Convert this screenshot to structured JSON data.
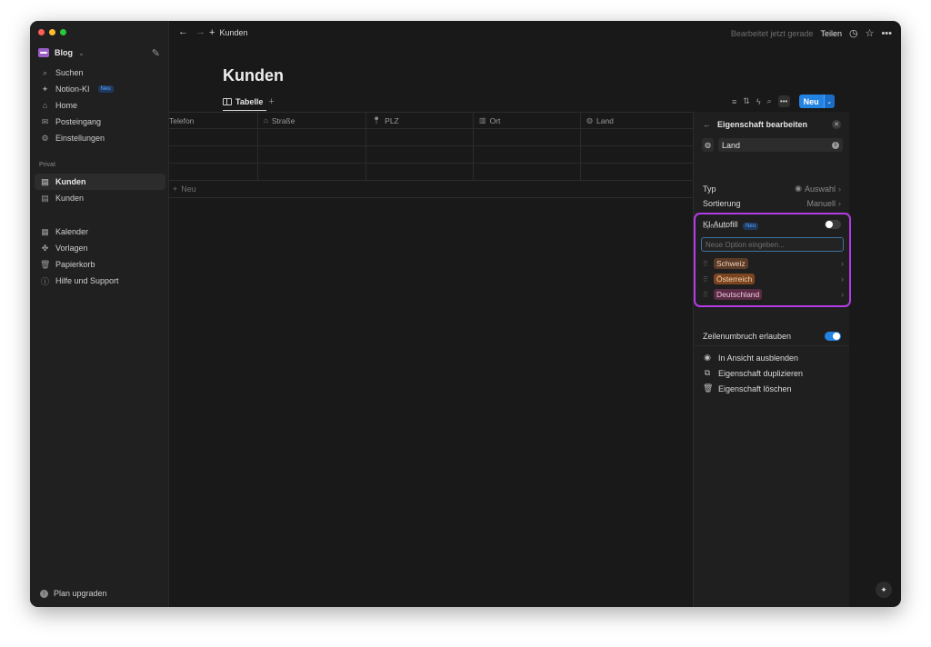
{
  "workspace": {
    "name": "Blog"
  },
  "sidebar": {
    "items": [
      {
        "label": "Suchen",
        "icon": "search-icon"
      },
      {
        "label": "Notion-KI",
        "icon": "sparkle-icon",
        "badge": "Neu"
      },
      {
        "label": "Home",
        "icon": "home-icon"
      },
      {
        "label": "Posteingang",
        "icon": "inbox-icon"
      },
      {
        "label": "Einstellungen",
        "icon": "gear-icon"
      }
    ],
    "private_label": "Privat",
    "pages": [
      {
        "label": "Kunden",
        "active": true
      },
      {
        "label": "Kunden",
        "active": false
      }
    ],
    "bottom_items": [
      {
        "label": "Kalender",
        "icon": "calendar-icon"
      },
      {
        "label": "Vorlagen",
        "icon": "templates-icon"
      },
      {
        "label": "Papierkorb",
        "icon": "trash-icon"
      },
      {
        "label": "Hilfe und Support",
        "icon": "help-icon"
      }
    ],
    "upgrade": "Plan upgraden"
  },
  "topbar": {
    "breadcrumb": "Kunden",
    "edited": "Bearbeitet jetzt gerade",
    "share": "Teilen"
  },
  "page": {
    "title": "Kunden",
    "view_tab": "Tabelle",
    "new_button": "Neu"
  },
  "table": {
    "columns": [
      {
        "label": "Telefon",
        "icon": ""
      },
      {
        "label": "Straße",
        "icon": "home-icon"
      },
      {
        "label": "PLZ",
        "icon": "pin-icon"
      },
      {
        "label": "Ort",
        "icon": "city-icon"
      },
      {
        "label": "Land",
        "icon": "globe-icon"
      }
    ],
    "add_row": "Neu"
  },
  "panel": {
    "title": "Eigenschaft bearbeiten",
    "property_name": "Land",
    "type_label": "Typ",
    "type_value": "Auswahl",
    "sort_label": "Sortierung",
    "sort_value": "Manuell",
    "autofill_label": "KI-Autofill",
    "autofill_badge": "Neu",
    "options_label": "Optionen",
    "options_placeholder": "Neue Option eingeben...",
    "options": [
      {
        "label": "Schweiz",
        "bg": "#5b3b28",
        "fg": "#f0d2b8"
      },
      {
        "label": "Österreich",
        "bg": "#7a4520",
        "fg": "#f6d3b0"
      },
      {
        "label": "Deutschland",
        "bg": "#5a2b44",
        "fg": "#f0c6dc"
      }
    ],
    "wrap_label": "Zeilenumbruch erlauben",
    "actions": [
      {
        "label": "In Ansicht ausblenden",
        "icon": "eye-icon"
      },
      {
        "label": "Eigenschaft duplizieren",
        "icon": "duplicate-icon"
      },
      {
        "label": "Eigenschaft löschen",
        "icon": "trash-icon"
      }
    ]
  },
  "colors": {
    "accent": "#2383e2",
    "highlight_border": "#b43ce6"
  }
}
